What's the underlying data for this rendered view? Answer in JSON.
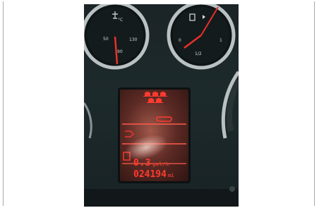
{
  "temp_gauge": {
    "unit_label": "°C",
    "tick_low": "50",
    "tick_mid": "90",
    "tick_high": "130"
  },
  "fuel_gauge": {
    "tick_empty": "0",
    "tick_half": "1/2",
    "tick_full": "1"
  },
  "display": {
    "trip_value": "0.3",
    "trip_unit": "gal/h",
    "odometer_value": "024194",
    "odometer_unit": "mi"
  },
  "colors": {
    "lcd_red": "#ff3a30",
    "needle_red": "#e8302a",
    "dash_dark": "#1b2426"
  }
}
